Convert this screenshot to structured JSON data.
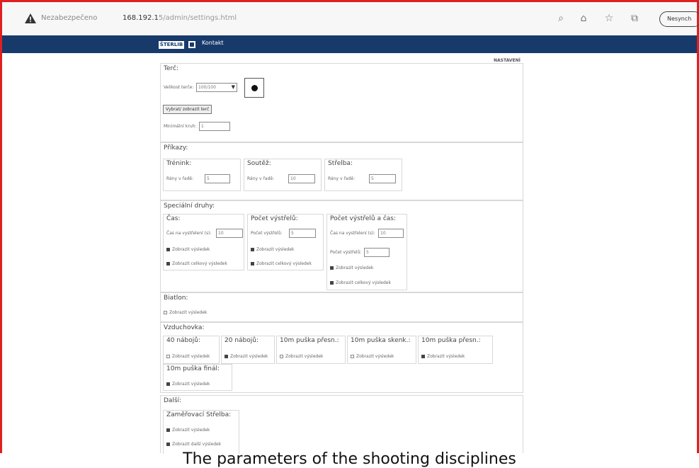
{
  "browser": {
    "warning": "Nezabezpečeno",
    "host": "168.192.1",
    "path": "5/admin/settings.html",
    "icons": [
      "search-icon",
      "home-icon",
      "favorites-icon",
      "collections-icon"
    ],
    "profile_button": "Nesynch"
  },
  "app": {
    "logo": "ŠTERLIB",
    "menu_link": "Kontakt"
  },
  "page_label": "NASTAVENÍ",
  "sections": {
    "terc": {
      "legend": "Terč:",
      "target_label": "Velikost terče:",
      "target_value": "100/100",
      "generate_button": "Vybrat/ zobrazit terč",
      "min_label": "Minimální kruh:",
      "min_value": "1"
    },
    "pokyny": {
      "legend": "Příkazy:",
      "groups": [
        {
          "legend": "Trénink:",
          "label": "Rány v řadě:",
          "value": "5"
        },
        {
          "legend": "Soutěž:",
          "label": "Rány v řadě:",
          "value": "10"
        },
        {
          "legend": "Střelba:",
          "label": "Rány v řadě:",
          "value": "5"
        }
      ]
    },
    "special": {
      "legend": "Speciální druhy:",
      "cas": {
        "legend": "Čas:",
        "time_label": "Čas na vystřelení (s):",
        "time_value": "10",
        "options": [
          "Zobrazit výsledek",
          "Zobrazit celkový výsledek"
        ]
      },
      "pocet": {
        "legend": "Počet výstřelů:",
        "count_label": "Počet výstřelů:",
        "count_value": "5",
        "options": [
          "Zobrazit výsledek",
          "Zobrazit celkový výsledek"
        ]
      },
      "pocet_cas": {
        "legend": "Počet výstřelů a čas:",
        "time_label": "Čas na vystřelení (s):",
        "time_value": "10",
        "count_label": "Počet výstřelů:",
        "count_value": "5",
        "options": [
          "Zobrazit výsledek",
          "Zobrazit celkový výsledek"
        ]
      }
    },
    "biatlon": {
      "legend": "Biatlon:",
      "option": "Zobrazit výsledek"
    },
    "vzduchovka": {
      "legend": "Vzduchovka:",
      "groups": [
        {
          "legend": "40 nábojů:",
          "option": "Zobrazit výsledek",
          "checked": false
        },
        {
          "legend": "20 nábojů:",
          "option": "Zobrazit výsledek",
          "checked": true
        },
        {
          "legend": "10m puška přesn.:",
          "option": "Zobrazit výsledek",
          "checked": false
        },
        {
          "legend": "10m puška skenk.:",
          "option": "Zobrazit výsledek",
          "checked": false
        },
        {
          "legend": "10m puška přesn.:",
          "option": "Zobrazit výsledek",
          "checked": true
        },
        {
          "legend": "10m puška finál:",
          "option": "Zobrazit výsledek",
          "checked": true
        }
      ]
    },
    "dalsi": {
      "legend": "Další:",
      "group_legend": "Zaměřovací Střelba:",
      "options": [
        "Zobrazit výsledek",
        "Zobrazit další výsledek"
      ]
    }
  },
  "caption": "The parameters of the shooting disciplines"
}
